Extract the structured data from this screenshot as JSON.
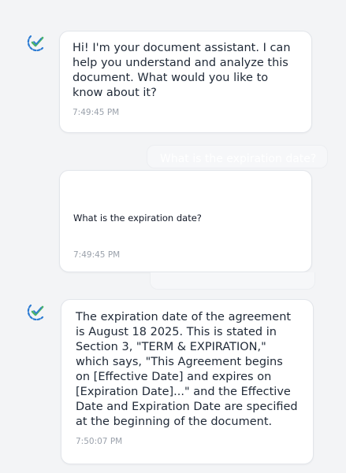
{
  "conversation": {
    "messages": [
      {
        "sender": "assistant",
        "text": "Hi! I'm your document assistant. I can help you understand and analyze this document. What would you like to know about it?",
        "time": "7:49:45 PM"
      },
      {
        "sender": "user",
        "faded_text": "What is the expiration date?",
        "text": "What is the expiration date?",
        "time": "7:49:45 PM"
      },
      {
        "sender": "assistant",
        "text": "The expiration date of the agreement is August 18 2025. This is stated in Section 3, \"TERM & EXPIRATION,\" which says, \"This Agreement begins on [Effective Date] and expires on [Expiration Date]...\" and the Effective Date and Expiration Date are specified at the beginning of the document.",
        "time": "7:50:07 PM"
      }
    ]
  },
  "icons": {
    "assistant_avatar": "assistant-check-icon"
  },
  "colors": {
    "background": "#f3f4f6",
    "bubble": "#ffffff",
    "avatar_blue": "#2b7bd3",
    "avatar_green": "#4bb36b",
    "timestamp": "#9aa1ab"
  }
}
